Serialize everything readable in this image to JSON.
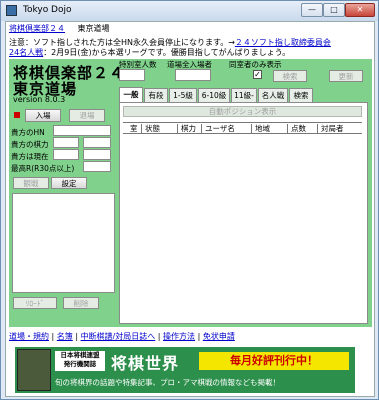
{
  "window": {
    "title": "Tokyo Dojo",
    "minimize_label": "—",
    "maximize_label": "□",
    "close_label": "✕"
  },
  "menu": {
    "link_label": "将棋倶楽部２４",
    "dojo_label": "東京道場"
  },
  "notices": [
    {
      "prefix": "注意：ソフト指しされた方は全HN永久会員停止になります。→",
      "link": "２４ソフト指し取締委員会"
    },
    {
      "prefix": "",
      "link": "24名人戦",
      "suffix": "：2月9日(金)から本選リーグです。優勝目指してがんばりましょう。"
    }
  ],
  "left_panel": {
    "title_line1": "将棋倶楽部２４",
    "title_line2": "東京道場",
    "version": "version 8.0.3",
    "enter_button": "入場",
    "exit_button": "退場",
    "hn_label": "貴方のHN",
    "rating_label": "貴方の棋力",
    "current_label": "貴方は現在",
    "rate_limit_label": "最高R(R30点以上)",
    "observe_button": "観戦",
    "settings_button": "設定",
    "reload_button": "ﾘﾛｰﾄﾞ",
    "delete_button": "削除"
  },
  "top_controls": {
    "special_rank_label": "特別室人数",
    "dojo_total_label": "道場全入場者",
    "same_only_label": "同室者のみ表示",
    "same_only_checked": true,
    "search_button": "検索",
    "refresh_button": "更新"
  },
  "tabs": [
    {
      "label": "一般",
      "active": true
    },
    {
      "label": "有段",
      "active": false
    },
    {
      "label": "1-5級",
      "active": false
    },
    {
      "label": "6-10級",
      "active": false
    },
    {
      "label": "11級-",
      "active": false
    },
    {
      "label": "名人戦",
      "active": false
    },
    {
      "label": "検索",
      "active": false
    }
  ],
  "table": {
    "position_button": "自動ポジション表示",
    "headers": [
      "室",
      "状態",
      "棋力",
      "ユーザ名",
      "地域",
      "点数",
      "対局者"
    ],
    "rows": []
  },
  "bottom_links": [
    "道場・規約",
    "名簿",
    "中断棋譜/対局日誌へ",
    "操作方法",
    "免状申請"
  ],
  "ad": {
    "publisher": "日本将棋連盟\n発行機関誌",
    "brand": "将棋世界",
    "monthly": "毎月好評刊行中！",
    "description": "旬の将棋界の話題や特集記事、プロ・アマ棋戦の情報なども掲載！"
  }
}
